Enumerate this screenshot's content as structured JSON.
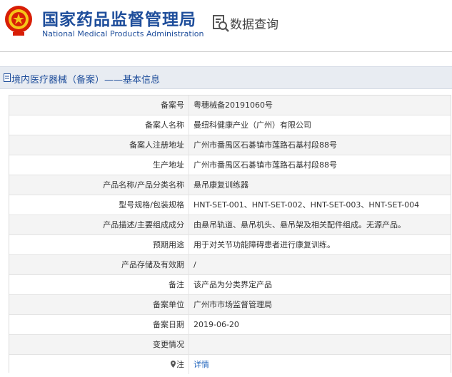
{
  "header": {
    "org_cn": "国家药品监督管理局",
    "org_en": "National Medical Products Administration",
    "query_label": "数据查询",
    "brand_color": "#1f4e9b"
  },
  "section": {
    "title": "境内医疗器械（备案）——基本信息"
  },
  "rows": [
    {
      "label": "备案号",
      "value": "粤穗械备20191060号"
    },
    {
      "label": "备案人名称",
      "value": "曼纽科健康产业（广州）有限公司"
    },
    {
      "label": "备案人注册地址",
      "value": "广州市番禺区石碁镇市莲路石基村段88号"
    },
    {
      "label": "生产地址",
      "value": "广州市番禺区石碁镇市莲路石基村段88号"
    },
    {
      "label": "产品名称/产品分类名称",
      "value": "悬吊康复训练器"
    },
    {
      "label": "型号规格/包装规格",
      "value": "HNT-SET-001、HNT-SET-002、HNT-SET-003、HNT-SET-004"
    },
    {
      "label": "产品描述/主要组成成分",
      "value": "由悬吊轨道、悬吊机头、悬吊架及相关配件组成。无源产品。"
    },
    {
      "label": "预期用途",
      "value": "用于对关节功能障碍患者进行康复训练。"
    },
    {
      "label": "产品存储及有效期",
      "value": "/"
    },
    {
      "label": "备注",
      "value": "该产品为分类界定产品"
    },
    {
      "label": "备案单位",
      "value": "广州市市场监督管理局"
    },
    {
      "label": "备案日期",
      "value": "2019-06-20"
    },
    {
      "label": "变更情况",
      "value": ""
    },
    {
      "label": "注",
      "value": "详情"
    }
  ]
}
